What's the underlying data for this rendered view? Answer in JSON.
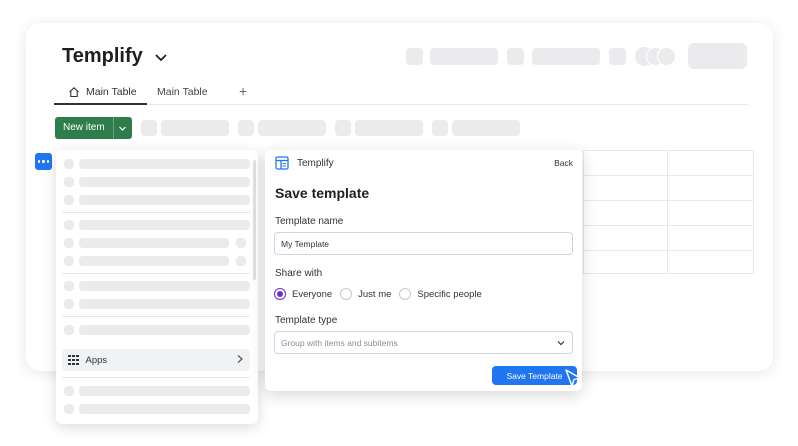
{
  "header": {
    "app_title": "Templify"
  },
  "tabs": [
    {
      "label": "Main Table",
      "icon": "home-icon",
      "active": true
    },
    {
      "label": "Main Table",
      "active": false
    }
  ],
  "tab_add": "+",
  "toolbar": {
    "new_item_label": "New item"
  },
  "side_menu": {
    "apps_label": "Apps"
  },
  "dialog": {
    "app_name": "Templify",
    "back_label": "Back",
    "title": "Save template",
    "template_name_label": "Template name",
    "template_name_value": "My Template",
    "share_with_label": "Share with",
    "share_options": [
      {
        "label": "Everyone",
        "selected": true
      },
      {
        "label": "Just me",
        "selected": false
      },
      {
        "label": "Specific people",
        "selected": false
      }
    ],
    "template_type_label": "Template type",
    "template_type_value": "Group with items and subitems",
    "save_button_label": "Save Template"
  },
  "colors": {
    "primary_button": "#1f76f0",
    "new_item_button": "#2f7d4a",
    "radio_selected": "#6c2fd1"
  }
}
